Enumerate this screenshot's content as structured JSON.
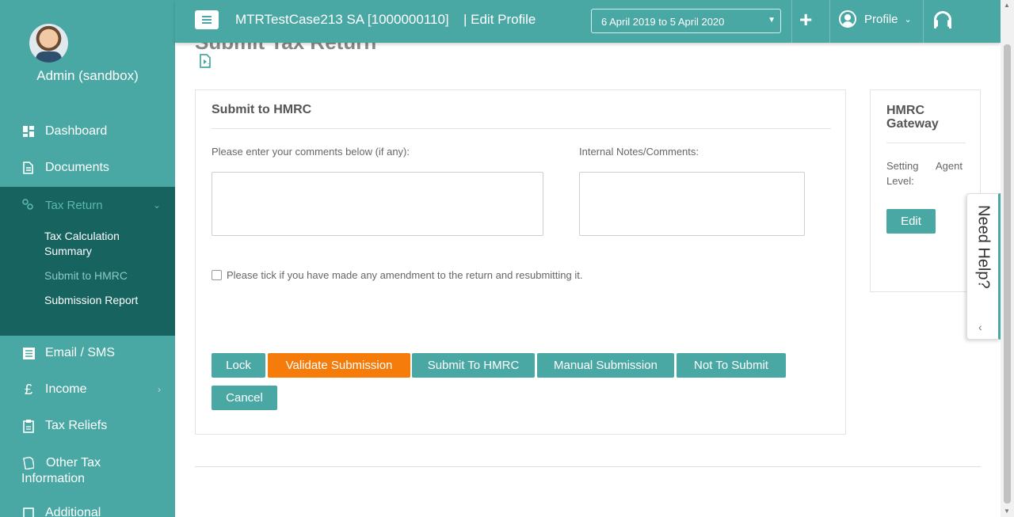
{
  "user": {
    "name": "Admin (sandbox)"
  },
  "sidebar": {
    "items": [
      {
        "label": "Dashboard",
        "icon": "dashboard-icon"
      },
      {
        "label": "Documents",
        "icon": "documents-icon"
      },
      {
        "label": "Tax Return",
        "icon": "tax-return-icon"
      },
      {
        "label": "Email / SMS",
        "icon": "email-icon"
      },
      {
        "label": "Income",
        "icon": "pound-icon"
      },
      {
        "label": "Tax Reliefs",
        "icon": "clipboard-icon"
      },
      {
        "label": "Other Tax Information",
        "icon": "document-icon"
      },
      {
        "label": "Additional",
        "icon": "additional-icon"
      }
    ],
    "tax_return_subitems": [
      {
        "label": "Tax Calculation Summary"
      },
      {
        "label": "Submit to HMRC"
      },
      {
        "label": "Submission Report"
      }
    ]
  },
  "header": {
    "client_name": "MTRTestCase213 SA [1000000110]",
    "edit_profile": "| Edit Profile",
    "period": "6 April 2019 to 5 April 2020",
    "profile_label": "Profile"
  },
  "page": {
    "title": "Submit Tax Return"
  },
  "submit_card": {
    "title": "Submit to HMRC",
    "comments_label": "Please enter your comments below (if any):",
    "notes_label": "Internal Notes/Comments:",
    "amend_checkbox_label": "Please tick if you have made any amendment to the return and resubmitting it.",
    "buttons": {
      "lock": "Lock",
      "validate": "Validate Submission",
      "submit": "Submit To HMRC",
      "manual": "Manual Submission",
      "not_submit": "Not To Submit",
      "cancel": "Cancel"
    }
  },
  "gateway_card": {
    "title": "HMRC Gateway",
    "setting_label": "Setting Level:",
    "setting_value": "Agent",
    "edit": "Edit"
  },
  "help": {
    "label": "Need Help?"
  },
  "colors": {
    "teal": "#4aa8a4",
    "dark_teal": "#16635f",
    "orange": "#f57c0a"
  }
}
